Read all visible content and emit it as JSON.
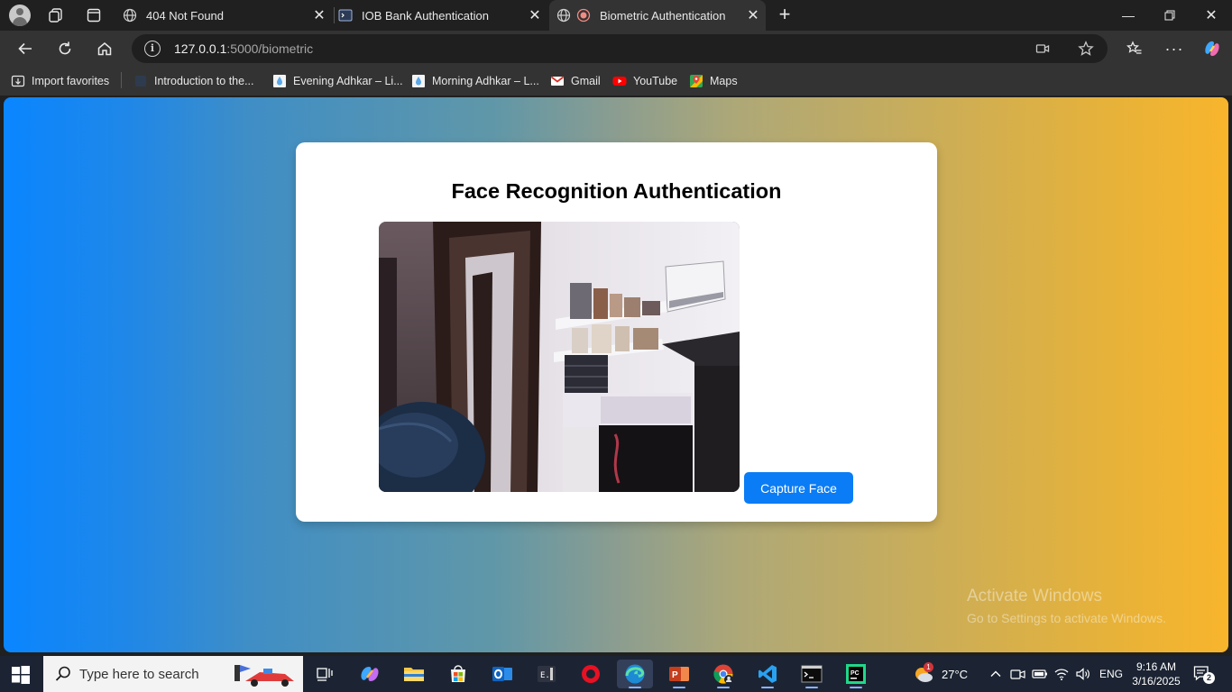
{
  "browser": {
    "tabs": [
      {
        "title": "404 Not Found",
        "icon": "globe-icon"
      },
      {
        "title": "IOB Bank Authentication",
        "icon": "terminal-icon"
      },
      {
        "title": "Biometric Authentication",
        "icon": "globe-icon",
        "active": true
      }
    ],
    "url": {
      "host": "127.0.0.1",
      "path": ":5000/biometric"
    },
    "favorites": [
      {
        "label": "Import favorites",
        "icon": "import-icon"
      },
      {
        "label": "Introduction to the...",
        "icon": "site-icon"
      },
      {
        "label": "Evening Adhkar – Li...",
        "icon": "drop-icon"
      },
      {
        "label": "Morning Adhkar – L...",
        "icon": "drop-icon"
      },
      {
        "label": "Gmail",
        "icon": "gmail-icon"
      },
      {
        "label": "YouTube",
        "icon": "youtube-icon"
      },
      {
        "label": "Maps",
        "icon": "maps-icon"
      }
    ]
  },
  "page": {
    "heading": "Face Recognition Authentication",
    "capture_label": "Capture Face",
    "video_label": "camera-feed"
  },
  "watermark": {
    "line1": "Activate Windows",
    "line2": "Go to Settings to activate Windows."
  },
  "taskbar": {
    "search_placeholder": "Type here to search",
    "weather": "27°C",
    "language": "ENG",
    "time": "9:16 AM",
    "date": "3/16/2025",
    "notifications": "2",
    "weather_badge": "1"
  }
}
